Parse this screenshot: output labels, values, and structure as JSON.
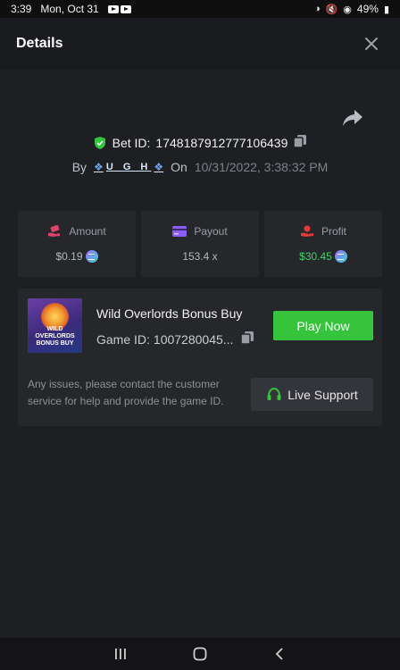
{
  "status_bar": {
    "time": "3:39",
    "date": "Mon, Oct 31",
    "battery": "49%"
  },
  "header": {
    "title": "Details"
  },
  "bet": {
    "id_label": "Bet ID:",
    "id_value": "1748187912777106439",
    "by_label": "By",
    "username": "U G H",
    "on_label": "On",
    "date": "10/31/2022, 3:38:32 PM"
  },
  "stats": [
    {
      "label": "Amount",
      "value": "$0.19",
      "icon": "money-hand-icon"
    },
    {
      "label": "Payout",
      "value": "153.4 x",
      "icon": "card-icon"
    },
    {
      "label": "Profit",
      "value": "$30.45",
      "icon": "profit-hand-icon"
    }
  ],
  "game": {
    "name": "Wild Overlords Bonus Buy",
    "thumb_title": "WILD OVERLORDS BONUS BUY",
    "id_label": "Game ID:",
    "id_value": "1007280045...",
    "play_label": "Play Now",
    "support_note": "Any issues, please contact the customer service for help and provide the game ID.",
    "live_support_label": "Live Support"
  },
  "colors": {
    "accent_green": "#35c43c",
    "profit_green": "#3fd36b",
    "background": "#1e1f22",
    "card": "#26272b"
  }
}
